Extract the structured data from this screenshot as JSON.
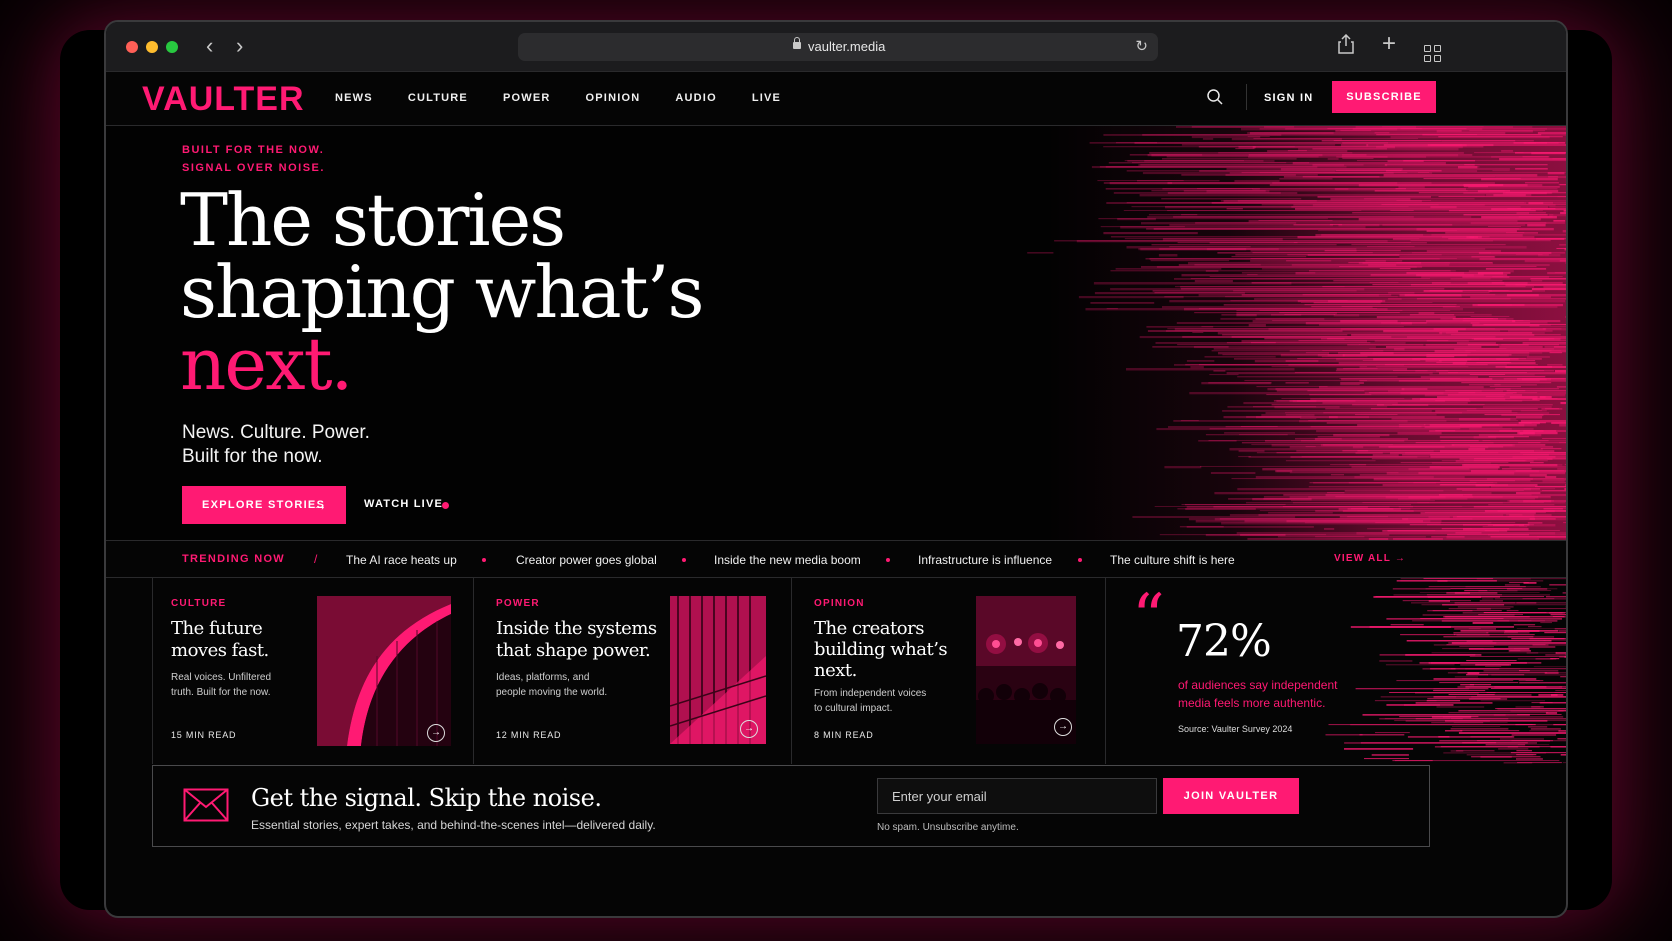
{
  "browser": {
    "url": "vaulter.media"
  },
  "site": {
    "logo": "VAULTER",
    "nav": [
      "NEWS",
      "CULTURE",
      "POWER",
      "OPINION",
      "AUDIO",
      "LIVE"
    ],
    "sign_in": "SIGN IN",
    "subscribe": "SUBSCRIBE",
    "accent_color": "#ff1a73"
  },
  "hero": {
    "kicker_line1": "BUILT FOR THE NOW.",
    "kicker_line2": "SIGNAL OVER NOISE.",
    "headline_line1": "The stories",
    "headline_line2": "shaping what’s",
    "headline_accent": "next.",
    "sub_line1": "News. Culture. Power.",
    "sub_line2": "Built for the now.",
    "cta_primary": "EXPLORE STORIES",
    "cta_secondary": "WATCH LIVE"
  },
  "trending": {
    "label": "TRENDING NOW",
    "items": [
      "The AI race heats up",
      "Creator power goes global",
      "Inside the new media boom",
      "Infrastructure is influence",
      "The culture shift is here"
    ],
    "view_all": "VIEW ALL"
  },
  "cards": [
    {
      "tag": "CULTURE",
      "title_line1": "The future",
      "title_line2": "moves fast.",
      "desc_line1": "Real voices. Unfiltered",
      "desc_line2": "truth. Built for the now.",
      "read_time": "15 MIN READ"
    },
    {
      "tag": "POWER",
      "title_line1": "Inside the systems",
      "title_line2": "that shape power.",
      "desc_line1": "Ideas, platforms, and",
      "desc_line2": "people moving the world.",
      "read_time": "12 MIN READ"
    },
    {
      "tag": "OPINION",
      "title_line1": "The creators",
      "title_line2": "building what’s",
      "title_line3": "next.",
      "desc_line1": "From independent voices",
      "desc_line2": "to cultural impact.",
      "read_time": "8 MIN READ"
    }
  ],
  "stat": {
    "quote_mark": "“",
    "value": "72%",
    "desc_line1": "of audiences say independent",
    "desc_line2": "media feels more authentic.",
    "source": "Source: Vaulter Survey 2024"
  },
  "newsletter": {
    "title": "Get the signal. Skip the noise.",
    "subtitle": "Essential stories, expert takes, and behind-the-scenes intel—delivered daily.",
    "email_placeholder": "Enter your email",
    "button": "JOIN VAULTER",
    "note": "No spam. Unsubscribe anytime."
  }
}
